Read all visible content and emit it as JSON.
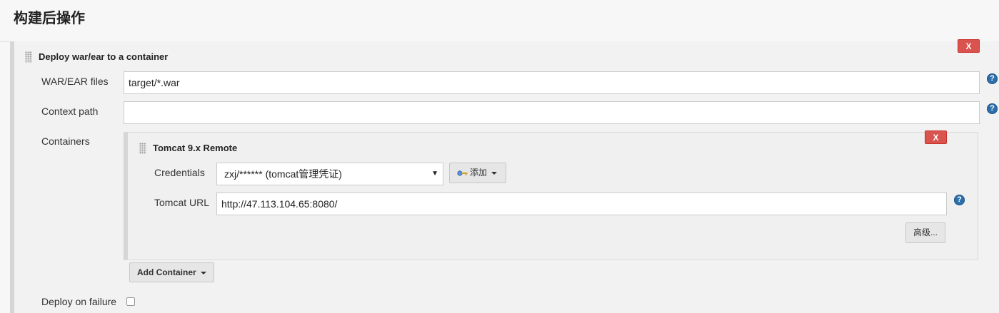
{
  "page_title": "构建后操作",
  "step": {
    "title": "Deploy war/ear to a container",
    "delete_label": "X",
    "war_files": {
      "label": "WAR/EAR files",
      "value": "target/*.war"
    },
    "context_path": {
      "label": "Context path",
      "value": ""
    },
    "containers_label": "Containers",
    "container": {
      "title": "Tomcat 9.x Remote",
      "delete_label": "X",
      "credentials": {
        "label": "Credentials",
        "selected": "zxj/****** (tomcat管理凭证)",
        "add_label": "添加"
      },
      "tomcat_url": {
        "label": "Tomcat URL",
        "value": "http://47.113.104.65:8080/"
      },
      "advanced_label": "高级..."
    },
    "add_container_label": "Add Container",
    "deploy_on_failure": {
      "label": "Deploy on failure",
      "checked": false
    }
  },
  "help_glyph": "?",
  "icons": [
    "grip-handle-icon",
    "help-icon",
    "key-icon",
    "caret-down-icon"
  ],
  "colors": {
    "delete": "#d9534f",
    "help": "#2c6fab",
    "section_bg": "#f2f2f2"
  }
}
